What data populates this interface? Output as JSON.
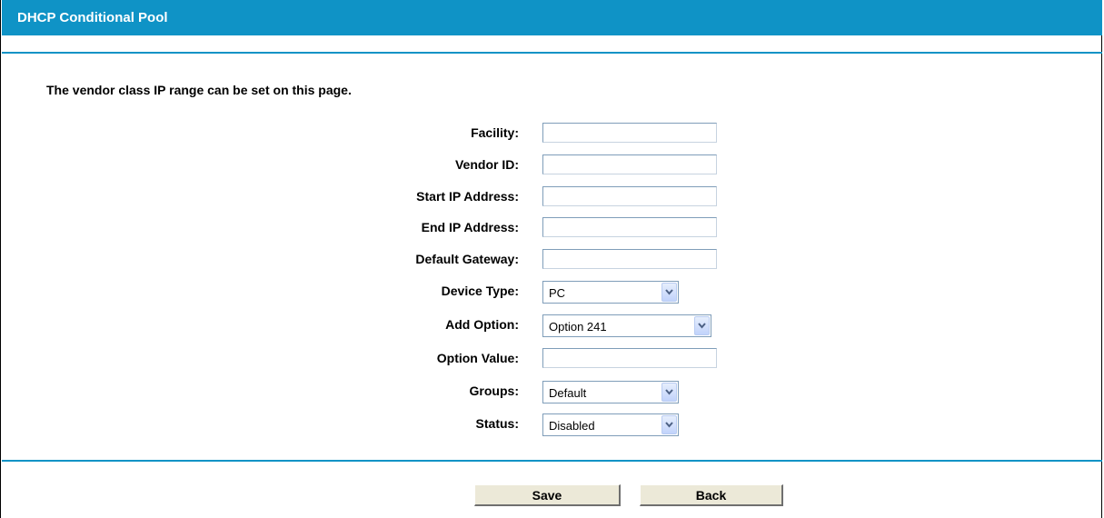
{
  "header": {
    "title": "DHCP Conditional Pool"
  },
  "intro_text": "The vendor class IP range can be set on this page.",
  "form": {
    "facility": {
      "label": "Facility:",
      "value": ""
    },
    "vendor_id": {
      "label": "Vendor ID:",
      "value": ""
    },
    "start_ip": {
      "label": "Start IP Address:",
      "value": ""
    },
    "end_ip": {
      "label": "End IP Address:",
      "value": ""
    },
    "default_gateway": {
      "label": "Default Gateway:",
      "value": ""
    },
    "device_type": {
      "label": "Device Type:",
      "selected": "PC"
    },
    "add_option": {
      "label": "Add Option:",
      "selected": "Option 241"
    },
    "option_value": {
      "label": "Option Value:",
      "value": ""
    },
    "groups": {
      "label": "Groups:",
      "selected": "Default"
    },
    "status": {
      "label": "Status:",
      "selected": "Disabled"
    }
  },
  "buttons": {
    "save_label": "Save",
    "back_label": "Back"
  },
  "colors": {
    "accent": "#0f93c6",
    "button_face": "#ece9d8",
    "field_border": "#7f9db9"
  },
  "icons": {
    "dropdown": "chevron-down-icon"
  }
}
